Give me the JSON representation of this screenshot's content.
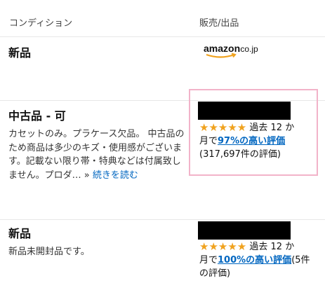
{
  "header": {
    "condition_label": "コンディション",
    "seller_label": "販売/出品"
  },
  "offers": [
    {
      "condition": "新品",
      "seller_logo": {
        "text": "amazon",
        "tld": ".co.jp",
        "icon": "amazon-smile-logo"
      }
    },
    {
      "condition": "中古品 - 可",
      "description": [
        "カセットのみ。プラケース欠品。 中古品の",
        "ため商品は多少のキズ・使用感がございま",
        "す。記載ない限り帯・特典などは付属致し",
        "ません。プロダ… »"
      ],
      "read_more": "続きを読む",
      "seller": {
        "stars": "★★★★★",
        "rating_prefix_line1": " 過去 12 か",
        "rating_prefix_line2": "月で",
        "positive_link": "97%の高い評価",
        "count_line": "(317,697件の評価)"
      }
    },
    {
      "condition": "新品",
      "description": [
        "新品未開封品です。"
      ],
      "seller": {
        "stars": "★★★★★",
        "rating_prefix_line1": " 過去 12 か",
        "rating_prefix_line2": "月で",
        "positive_link": "100%の高い評価",
        "count_suffix": "(5件",
        "count_line2": "の評価)"
      }
    }
  ],
  "colors": {
    "link": "#0066c0",
    "star": "#f0a21e",
    "highlight": "#f2b3c9"
  }
}
